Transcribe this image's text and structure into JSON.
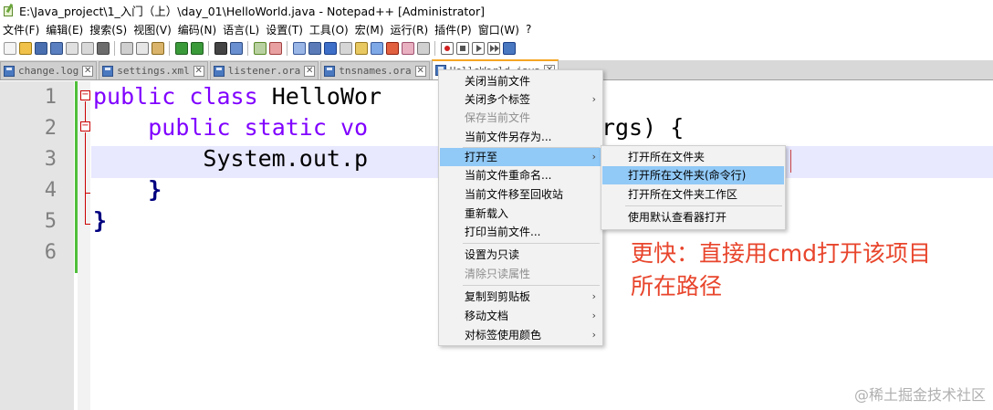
{
  "window": {
    "title": "E:\\Java_project\\1_入门（上）\\day_01\\HelloWorld.java - Notepad++ [Administrator]"
  },
  "menubar": {
    "items": [
      "文件(F)",
      "编辑(E)",
      "搜索(S)",
      "视图(V)",
      "编码(N)",
      "语言(L)",
      "设置(T)",
      "工具(O)",
      "宏(M)",
      "运行(R)",
      "插件(P)",
      "窗口(W)",
      "?"
    ]
  },
  "tabs": [
    {
      "label": "change.log"
    },
    {
      "label": "settings.xml"
    },
    {
      "label": "listener.ora"
    },
    {
      "label": "tnsnames.ora"
    },
    {
      "label": "HelloWorld.java"
    }
  ],
  "editor": {
    "line_numbers": [
      "1",
      "2",
      "3",
      "4",
      "5",
      "6"
    ],
    "lines": [
      {
        "kw1": "public",
        "kw2": "class",
        "rest": "HelloWor"
      },
      {
        "kw1": "public",
        "kw2": "static",
        "kw3": "vo",
        "rest": "ring[] args) {"
      },
      {
        "rest": "System.out.p"
      },
      {
        "rest": "}"
      },
      {
        "rest": "}"
      },
      {
        "rest": ""
      }
    ]
  },
  "context_menu": {
    "items": [
      {
        "label": "关闭当前文件"
      },
      {
        "label": "关闭多个标签",
        "arrow": "›"
      },
      {
        "label": "保存当前文件"
      },
      {
        "label": "当前文件另存为..."
      },
      {
        "label": "打开至",
        "arrow": "›"
      },
      {
        "label": "当前文件重命名..."
      },
      {
        "label": "当前文件移至回收站"
      },
      {
        "label": "重新载入"
      },
      {
        "label": "打印当前文件..."
      },
      {
        "label": "设置为只读"
      },
      {
        "label": "清除只读属性"
      },
      {
        "label": "复制到剪贴板",
        "arrow": "›"
      },
      {
        "label": "移动文档",
        "arrow": "›"
      },
      {
        "label": "对标签使用颜色",
        "arrow": "›"
      }
    ]
  },
  "submenu": {
    "items": [
      {
        "label": "打开所在文件夹"
      },
      {
        "label": "打开所在文件夹(命令行)"
      },
      {
        "label": "打开所在文件夹工作区"
      },
      {
        "label": "使用默认查看器打开"
      }
    ]
  },
  "annotation": {
    "line1": "更快：直接用cmd打开该项目",
    "line2": "所在路径"
  },
  "watermark": "@稀土掘金技术社区",
  "tab_close_glyph": "✕",
  "colors": {
    "keyword": "#8000ff",
    "operator": "#000080",
    "annotation": "#e8452c",
    "menu_highlight": "#91c9f7",
    "active_tab_accent": "#f5a623",
    "change_bar": "#4fbf3a"
  }
}
